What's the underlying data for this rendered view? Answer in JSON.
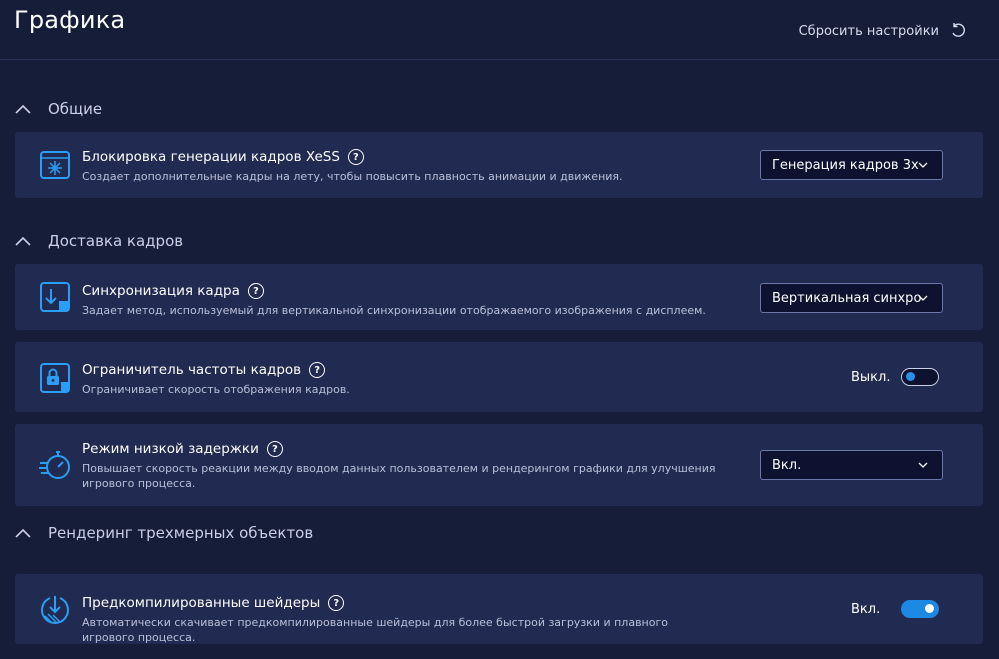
{
  "header": {
    "title": "Графика",
    "reset_label": "Сбросить настройки"
  },
  "sections": [
    {
      "label": "Общие",
      "items": [
        {
          "title": "Блокировка генерации кадров XeSS",
          "desc": "Создает дополнительные кадры на лету, чтобы повысить плавность анимации и движения.",
          "control": "dropdown",
          "value": "Генерация кадров 3x"
        }
      ]
    },
    {
      "label": "Доставка кадров",
      "items": [
        {
          "title": "Синхронизация кадра",
          "desc": "Задает метод, используемый для вертикальной синхронизации отображаемого изображения с дисплеем.",
          "control": "dropdown",
          "value": "Вертикальная синхро"
        },
        {
          "title": "Ограничитель частоты кадров",
          "desc": "Ограничивает скорость отображения кадров.",
          "control": "toggle",
          "value": "Выкл.",
          "on": false
        },
        {
          "title": "Режим низкой задержки",
          "desc": "Повышает скорость реакции между вводом данных пользователем и рендерингом графики для улучшения игрового процесса.",
          "control": "dropdown",
          "value": "Вкл."
        }
      ]
    },
    {
      "label": "Рендеринг трехмерных объектов",
      "items": [
        {
          "title": "Предкомпилированные шейдеры",
          "desc": "Автоматически скачивает предкомпилированные шейдеры для более быстрой загрузки и плавного игрового процесса.",
          "control": "toggle",
          "value": "Вкл.",
          "on": true
        }
      ]
    }
  ],
  "colors": {
    "background": "#161d38",
    "card": "#212a50",
    "accent": "#1e88e5",
    "icon": "#2a9df4"
  },
  "icons": {
    "reset": "reset-icon",
    "collapse": "chevron-up-icon",
    "xess": "frame-generation-icon",
    "sync": "frame-sync-icon",
    "limiter": "frame-limiter-icon",
    "latency": "low-latency-icon",
    "shaders": "shader-download-icon"
  }
}
